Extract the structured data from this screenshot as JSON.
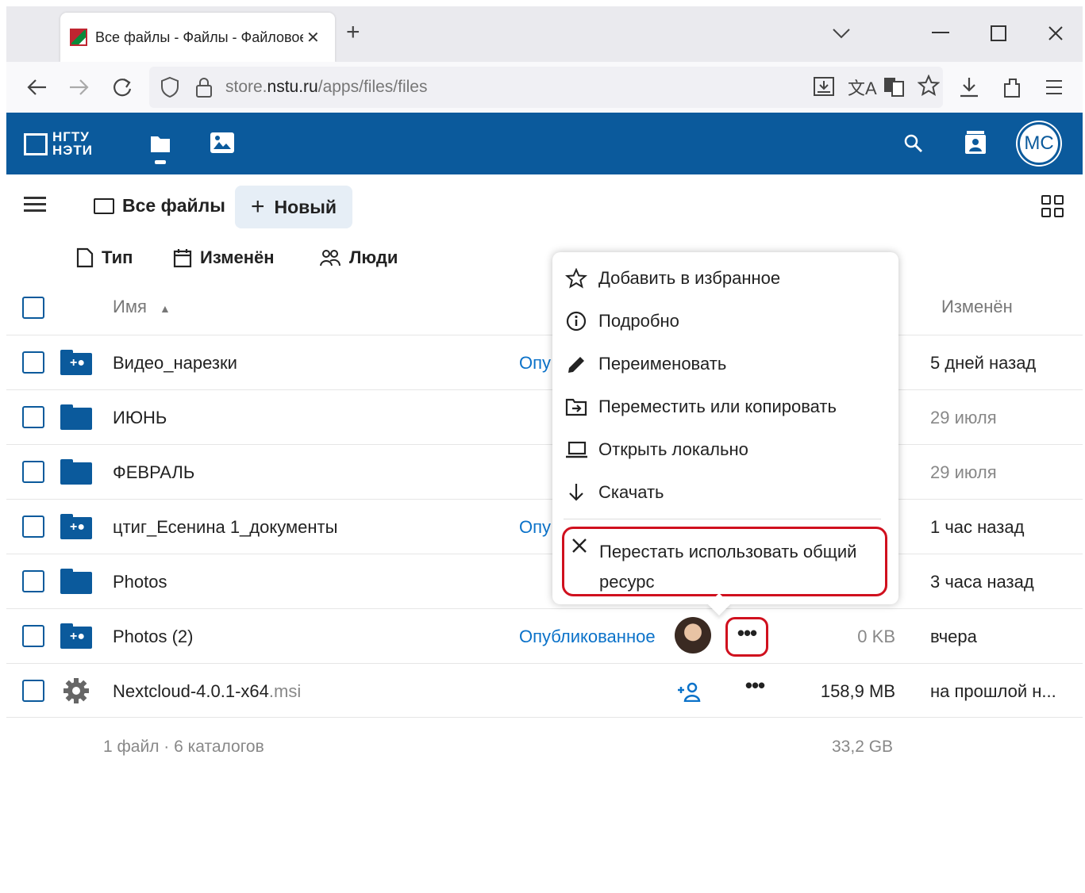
{
  "browser": {
    "tab_title": "Все файлы - Файлы - Файловое хранилище",
    "tab_close": "✕",
    "new_tab": "+",
    "url_prefix": "store.",
    "url_domain": "nstu.ru",
    "url_path": "/apps/files/files"
  },
  "app": {
    "logo_line1": "НГТУ",
    "logo_line2": "НЭТИ",
    "avatar_initials": "МС"
  },
  "toolbar": {
    "breadcrumb": "Все файлы",
    "new_button": "Новый"
  },
  "filters": {
    "type": "Тип",
    "modified": "Изменён",
    "people": "Люди"
  },
  "table": {
    "col_name": "Имя",
    "col_modified": "Изменён",
    "rows": [
      {
        "name": "Видео_нарезки",
        "ext": "",
        "published": "Опу",
        "size": "",
        "modified": "5 дней назад",
        "mod_grey": false
      },
      {
        "name": "ИЮНЬ",
        "ext": "",
        "published": "",
        "size": "",
        "modified": "29 июля",
        "mod_grey": true
      },
      {
        "name": "ФЕВРАЛЬ",
        "ext": "",
        "published": "",
        "size": "",
        "modified": "29 июля",
        "mod_grey": true
      },
      {
        "name": "цтиг_Есенина 1_документы",
        "ext": "",
        "published": "Опу",
        "size": "",
        "modified": "1 час назад",
        "mod_grey": false
      },
      {
        "name": "Photos",
        "ext": "",
        "published": "",
        "size": "",
        "modified": "3 часа назад",
        "mod_grey": false
      },
      {
        "name": "Photos (2)",
        "ext": "",
        "published": "Опубликованное",
        "size": "0 KB",
        "modified": "вчера",
        "mod_grey": false
      },
      {
        "name": "Nextcloud-4.0.1-x64",
        "ext": ".msi",
        "published": "",
        "size": "158,9 MB",
        "modified": "на прошлой н...",
        "mod_grey": false
      }
    ],
    "dots": "•••",
    "footer_count": "1 файл · 6 каталогов",
    "footer_size": "33,2 GB"
  },
  "menu": {
    "items": [
      {
        "icon": "star-icon",
        "label": "Добавить в избранное"
      },
      {
        "icon": "info-icon",
        "label": "Подробно"
      },
      {
        "icon": "pencil-icon",
        "label": "Переименовать"
      },
      {
        "icon": "folder-move-icon",
        "label": "Переместить или копировать"
      },
      {
        "icon": "laptop-icon",
        "label": "Открыть локально"
      },
      {
        "icon": "download-icon",
        "label": "Скачать"
      }
    ],
    "danger_label": "Перестать использовать общий ресурс"
  },
  "colors": {
    "brand": "#0b5a9c",
    "link": "#0b72c9",
    "highlight": "#d0101e"
  }
}
